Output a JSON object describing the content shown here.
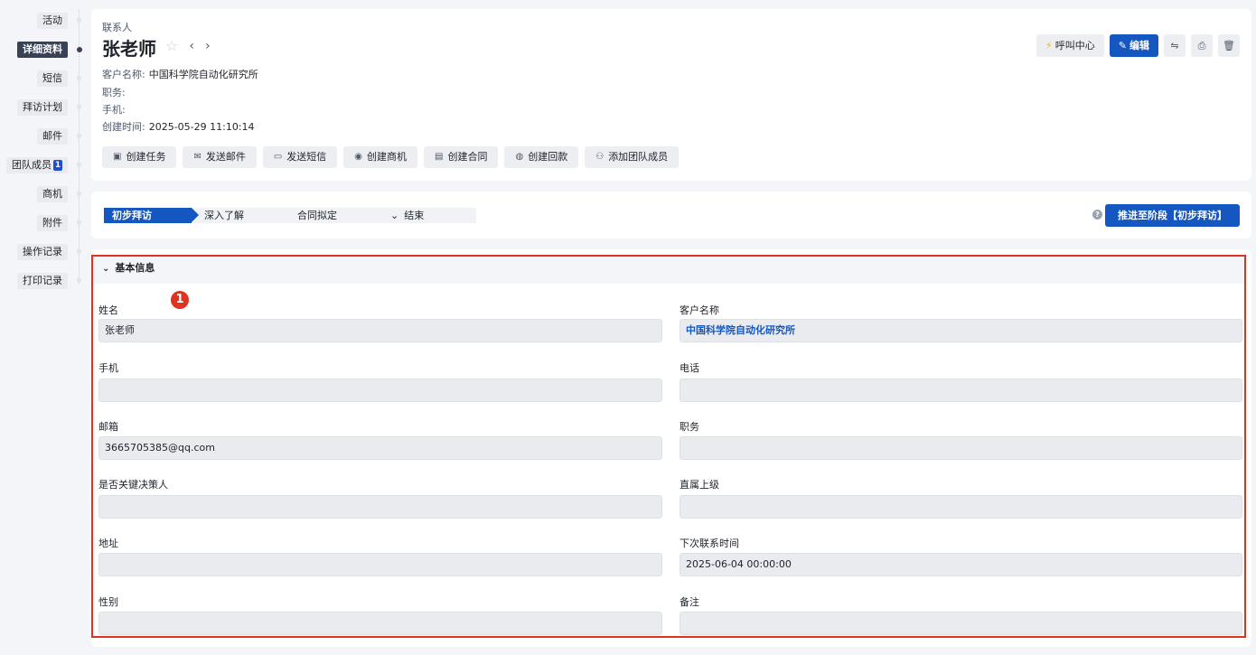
{
  "nav": {
    "items": [
      {
        "label": "活动"
      },
      {
        "label": "详细资料"
      },
      {
        "label": "短信"
      },
      {
        "label": "拜访计划"
      },
      {
        "label": "邮件"
      },
      {
        "label": "团队成员",
        "badge": "1"
      },
      {
        "label": "商机"
      },
      {
        "label": "附件"
      },
      {
        "label": "操作记录"
      },
      {
        "label": "打印记录"
      }
    ]
  },
  "header": {
    "breadcrumb": "联系人",
    "title": "张老师",
    "customer_label": "客户名称:",
    "customer_value": "中国科学院自动化研究所",
    "position_label": "职务:",
    "position_value": "",
    "mobile_label": "手机:",
    "mobile_value": "",
    "created_label": "创建时间:",
    "created_value": "2025-05-29 11:10:14",
    "call_center": "呼叫中心",
    "edit": "编辑",
    "actions": [
      "创建任务",
      "发送邮件",
      "发送短信",
      "创建商机",
      "创建合同",
      "创建回款",
      "添加团队成员"
    ]
  },
  "stages": {
    "items": [
      "初步拜访",
      "深入了解",
      "合同拟定",
      "结束"
    ],
    "advance_label": "推进至阶段【初步拜访】"
  },
  "basic_info": {
    "title": "基本信息",
    "marker": "1",
    "fields": {
      "name_label": "姓名",
      "name_value": "张老师",
      "customer_label": "客户名称",
      "customer_value": "中国科学院自动化研究所",
      "mobile_label": "手机",
      "mobile_value": "",
      "phone_label": "电话",
      "phone_value": "",
      "email_label": "邮箱",
      "email_value": "3665705385@qq.com",
      "position_label": "职务",
      "position_value": "",
      "decision_label": "是否关键决策人",
      "decision_value": "",
      "superior_label": "直属上级",
      "superior_value": "",
      "address_label": "地址",
      "address_value": "",
      "next_contact_label": "下次联系时间",
      "next_contact_value": "2025-06-04 00:00:00",
      "gender_label": "性别",
      "gender_value": "",
      "remark_label": "备注",
      "remark_value": ""
    }
  },
  "colors": {
    "primary": "#1557c0",
    "highlight": "#e0321e",
    "nav_active": "#394254"
  }
}
